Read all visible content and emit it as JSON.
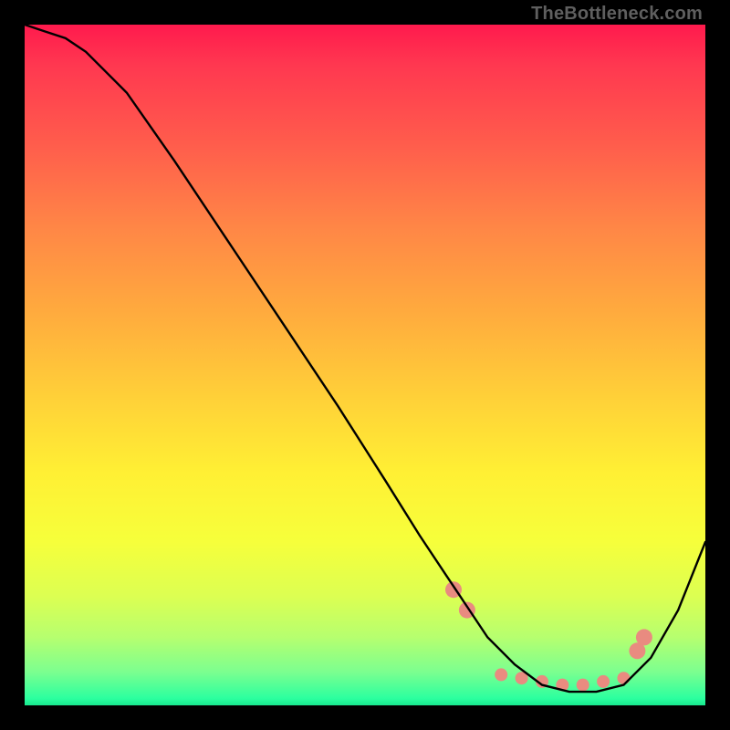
{
  "watermark": "TheBottleneck.com",
  "chart_data": {
    "type": "line",
    "title": "",
    "xlabel": "",
    "ylabel": "",
    "xlim": [
      0,
      100
    ],
    "ylim": [
      0,
      100
    ],
    "grid": false,
    "legend": false,
    "background_gradient": {
      "orientation": "vertical",
      "stops": [
        {
          "pos": 0.0,
          "color": "#ff1a4d"
        },
        {
          "pos": 0.42,
          "color": "#ffaa3e"
        },
        {
          "pos": 0.76,
          "color": "#f6ff3b"
        },
        {
          "pos": 1.0,
          "color": "#18e88f"
        }
      ]
    },
    "series": [
      {
        "name": "bottleneck-curve",
        "color": "#000000",
        "x": [
          0,
          3,
          6,
          9,
          12,
          15,
          22,
          30,
          38,
          46,
          53,
          58,
          62,
          64,
          68,
          72,
          76,
          80,
          84,
          88,
          92,
          96,
          100
        ],
        "y": [
          100,
          99,
          98,
          96,
          93,
          90,
          80,
          68,
          56,
          44,
          33,
          25,
          19,
          16,
          10,
          6,
          3,
          2,
          2,
          3,
          7,
          14,
          24
        ]
      }
    ],
    "highlight_points": {
      "note": "salmon dots near curve minimum",
      "color": "#e98b80",
      "radius_main": 9,
      "radius_small": 7,
      "points": [
        {
          "x": 63,
          "y": 17
        },
        {
          "x": 65,
          "y": 14
        },
        {
          "x": 70,
          "y": 4.5
        },
        {
          "x": 73,
          "y": 4
        },
        {
          "x": 76,
          "y": 3.5
        },
        {
          "x": 79,
          "y": 3
        },
        {
          "x": 82,
          "y": 3
        },
        {
          "x": 85,
          "y": 3.5
        },
        {
          "x": 88,
          "y": 4
        },
        {
          "x": 90,
          "y": 8
        },
        {
          "x": 91,
          "y": 10
        }
      ]
    }
  }
}
